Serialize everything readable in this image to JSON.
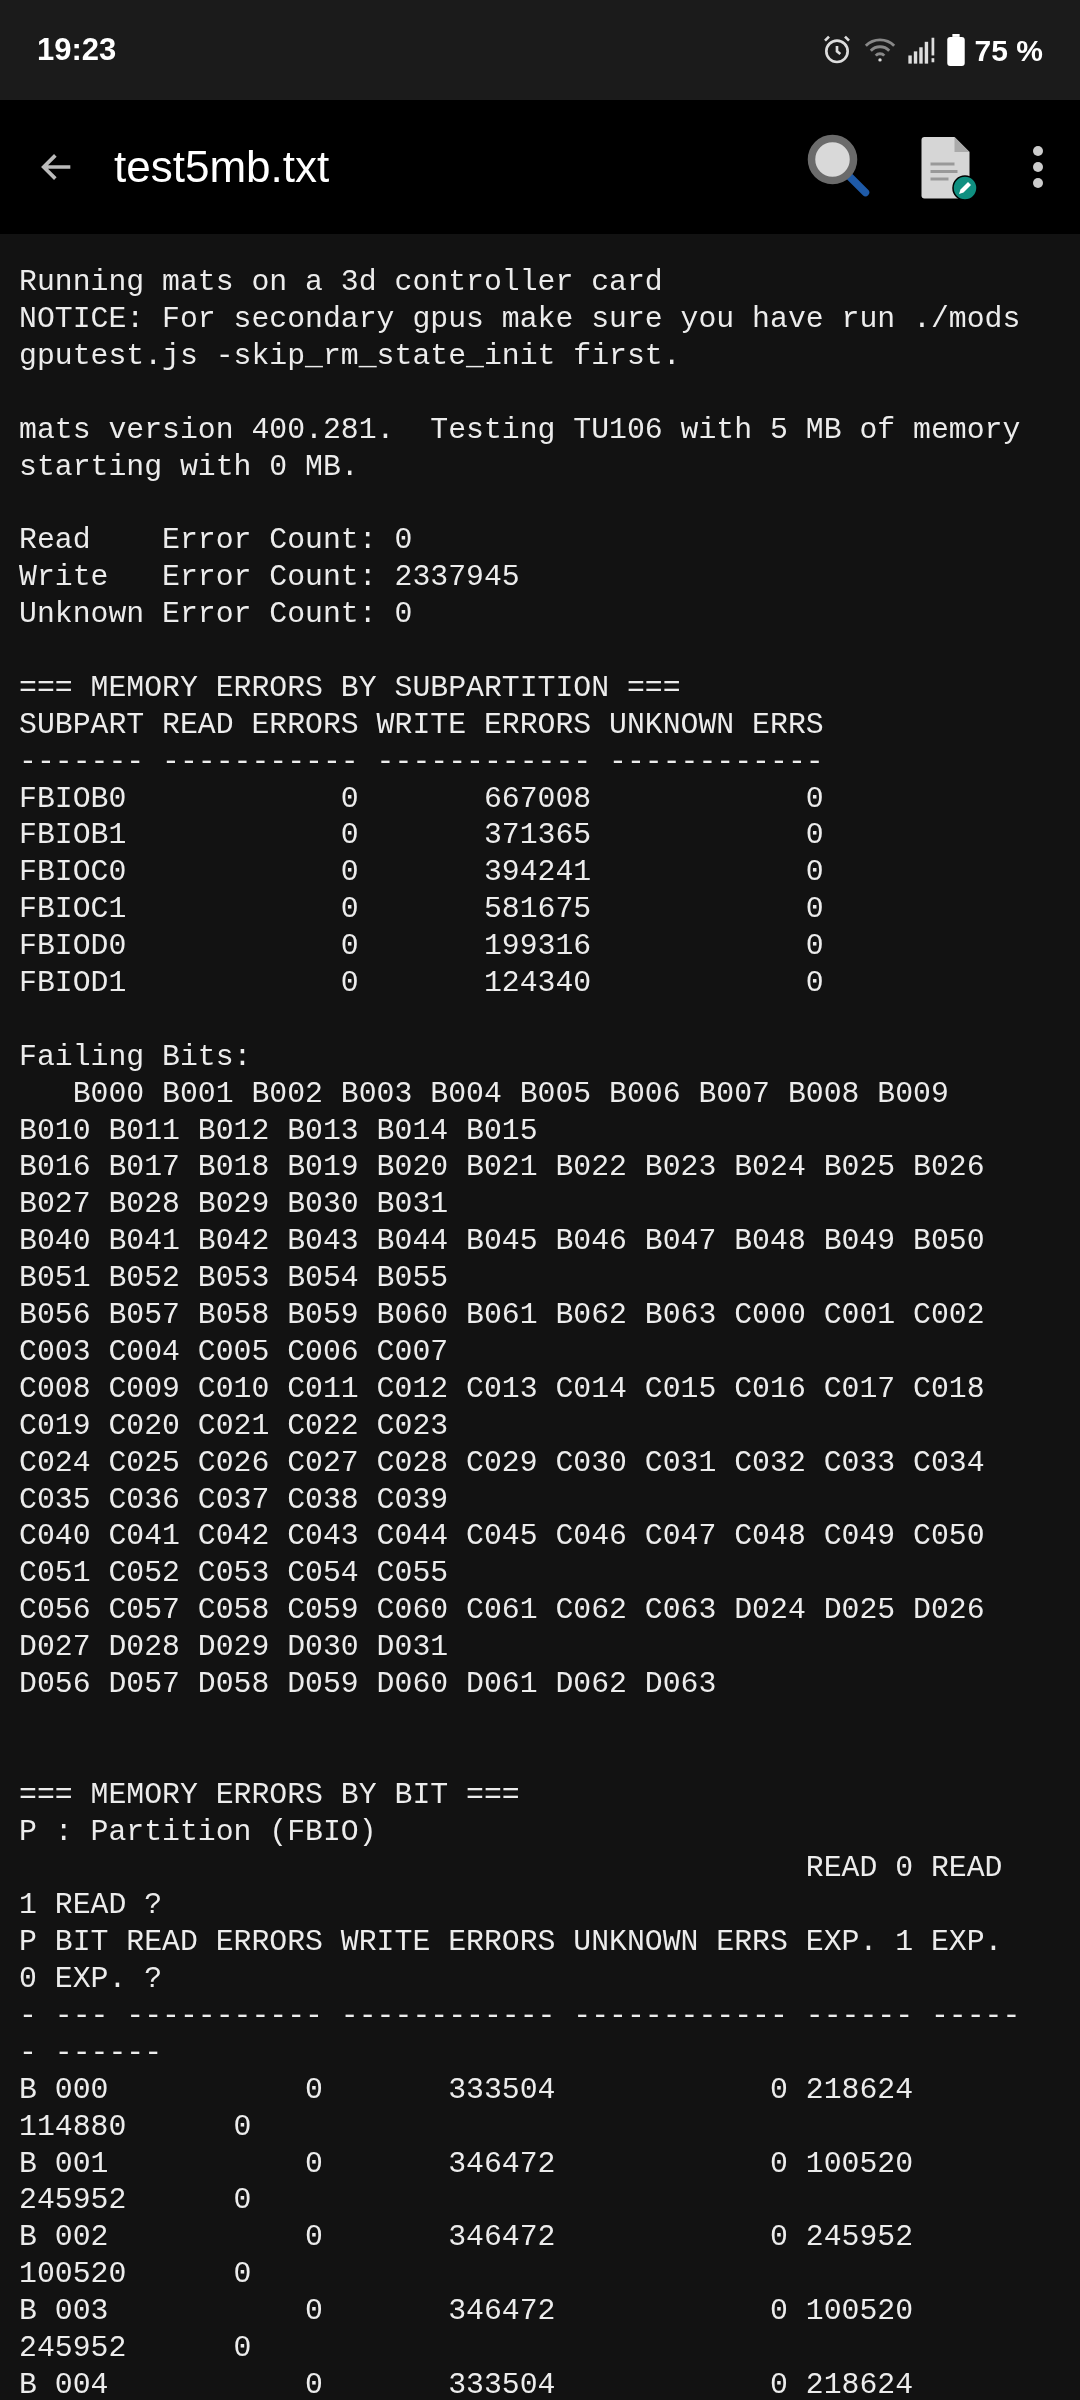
{
  "status_bar": {
    "time": "19:23",
    "battery": "75 %"
  },
  "toolbar": {
    "title": "test5mb.txt"
  },
  "lines": [
    {
      "kind": "text",
      "text": "Running mats on a 3d controller card"
    },
    {
      "kind": "text",
      "text": "NOTICE: For secondary gpus make sure you have run ./mods"
    },
    {
      "kind": "text",
      "text": "gputest.js -skip_rm_state_init first."
    },
    {
      "kind": "blank"
    },
    {
      "kind": "text",
      "text": "mats version 400.281.  Testing TU106 with 5 MB of memory"
    },
    {
      "kind": "text",
      "text": "starting with 0 MB."
    },
    {
      "kind": "blank"
    },
    {
      "kind": "text",
      "text": "Read    Error Count: 0"
    },
    {
      "kind": "text",
      "text": "Write   Error Count: 2337945"
    },
    {
      "kind": "text",
      "text": "Unknown Error Count: 0"
    },
    {
      "kind": "blank"
    },
    {
      "kind": "text",
      "text": "=== MEMORY ERRORS BY SUBPARTITION ==="
    },
    {
      "kind": "text",
      "text": "SUBPART READ ERRORS WRITE ERRORS UNKNOWN ERRS"
    },
    {
      "kind": "text",
      "text": "------- ----------- ------------ ------------"
    },
    {
      "kind": "text",
      "text": "FBIOB0            0       667008            0"
    },
    {
      "kind": "text",
      "text": "FBIOB1            0       371365            0"
    },
    {
      "kind": "text",
      "text": "FBIOC0            0       394241            0"
    },
    {
      "kind": "text",
      "text": "FBIOC1            0       581675            0"
    },
    {
      "kind": "text",
      "text": "FBIOD0            0       199316            0"
    },
    {
      "kind": "text",
      "text": "FBIOD1            0       124340            0"
    },
    {
      "kind": "blank"
    },
    {
      "kind": "text",
      "text": "Failing Bits:"
    },
    {
      "kind": "text",
      "text": "   B000 B001 B002 B003 B004 B005 B006 B007 B008 B009"
    },
    {
      "kind": "text",
      "text": "B010 B011 B012 B013 B014 B015"
    },
    {
      "kind": "text",
      "text": "B016 B017 B018 B019 B020 B021 B022 B023 B024 B025 B026"
    },
    {
      "kind": "text",
      "text": "B027 B028 B029 B030 B031"
    },
    {
      "kind": "text",
      "text": "B040 B041 B042 B043 B044 B045 B046 B047 B048 B049 B050"
    },
    {
      "kind": "text",
      "text": "B051 B052 B053 B054 B055"
    },
    {
      "kind": "text",
      "text": "B056 B057 B058 B059 B060 B061 B062 B063 C000 C001 C002"
    },
    {
      "kind": "text",
      "text": "C003 C004 C005 C006 C007"
    },
    {
      "kind": "text",
      "text": "C008 C009 C010 C011 C012 C013 C014 C015 C016 C017 C018"
    },
    {
      "kind": "text",
      "text": "C019 C020 C021 C022 C023"
    },
    {
      "kind": "text",
      "text": "C024 C025 C026 C027 C028 C029 C030 C031 C032 C033 C034"
    },
    {
      "kind": "text",
      "text": "C035 C036 C037 C038 C039"
    },
    {
      "kind": "text",
      "text": "C040 C041 C042 C043 C044 C045 C046 C047 C048 C049 C050"
    },
    {
      "kind": "text",
      "text": "C051 C052 C053 C054 C055"
    },
    {
      "kind": "text",
      "text": "C056 C057 C058 C059 C060 C061 C062 C063 D024 D025 D026"
    },
    {
      "kind": "text",
      "text": "D027 D028 D029 D030 D031"
    },
    {
      "kind": "text",
      "text": "D056 D057 D058 D059 D060 D061 D062 D063"
    },
    {
      "kind": "blank"
    },
    {
      "kind": "blank"
    },
    {
      "kind": "text",
      "text": "=== MEMORY ERRORS BY BIT ==="
    },
    {
      "kind": "text",
      "text": "P : Partition (FBIO)"
    },
    {
      "kind": "text",
      "text": "                                            READ 0 READ"
    },
    {
      "kind": "text",
      "text": "1 READ ?"
    },
    {
      "kind": "text",
      "text": "P BIT READ ERRORS WRITE ERRORS UNKNOWN ERRS EXP. 1 EXP."
    },
    {
      "kind": "text",
      "text": "0 EXP. ?"
    },
    {
      "kind": "text",
      "text": "- --- ----------- ------------ ------------ ------ -----"
    },
    {
      "kind": "text",
      "text": "- ------"
    },
    {
      "kind": "text",
      "text": "B 000           0       333504            0 218624"
    },
    {
      "kind": "text",
      "text": "114880      0"
    },
    {
      "kind": "text",
      "text": "B 001           0       346472            0 100520"
    },
    {
      "kind": "text",
      "text": "245952      0"
    },
    {
      "kind": "text",
      "text": "B 002           0       346472            0 245952"
    },
    {
      "kind": "text",
      "text": "100520      0"
    },
    {
      "kind": "text",
      "text": "B 003           0       346472            0 100520"
    },
    {
      "kind": "text",
      "text": "245952      0"
    },
    {
      "kind": "text",
      "text": "B 004           0       333504            0 218624"
    }
  ]
}
